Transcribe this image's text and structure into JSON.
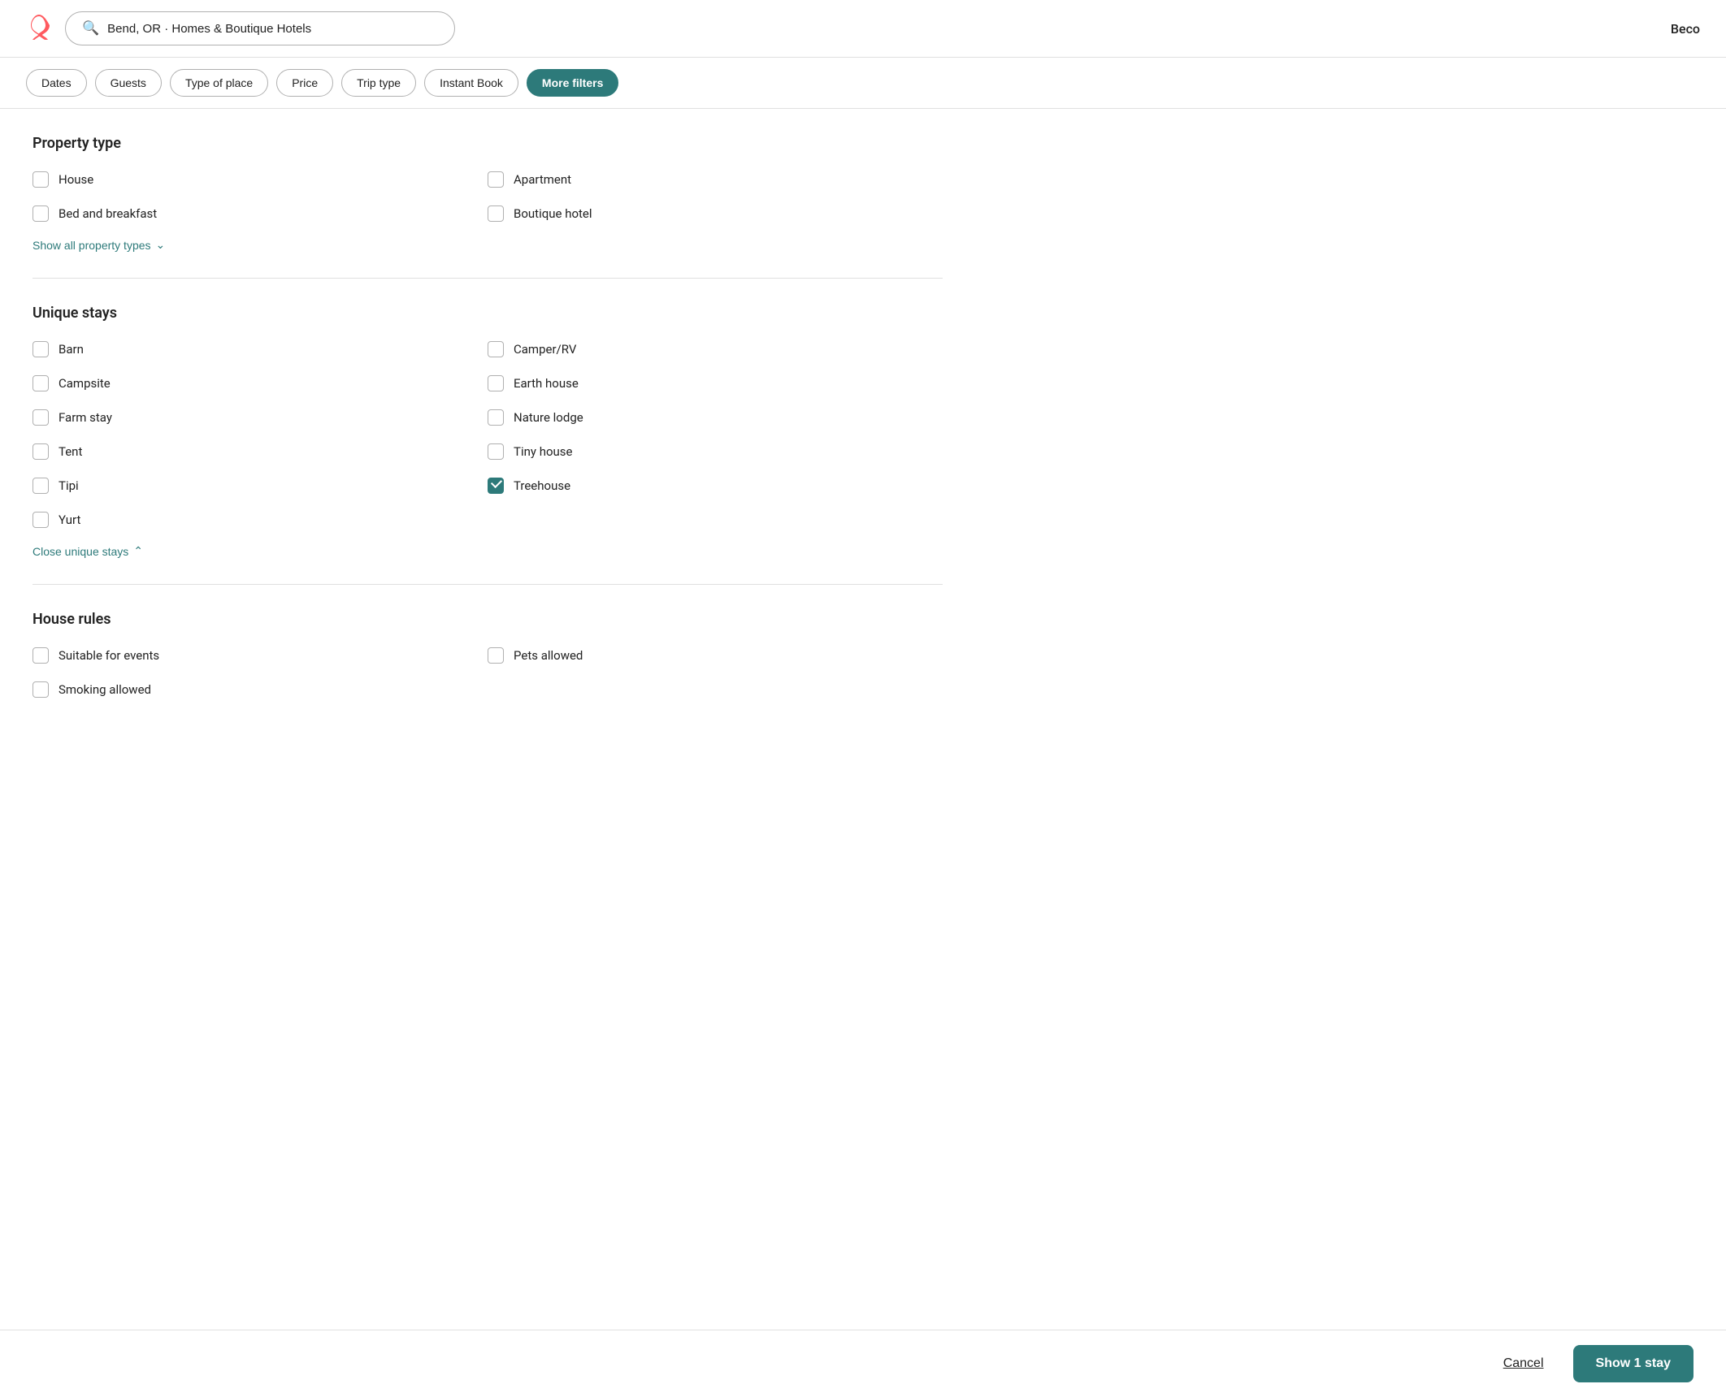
{
  "header": {
    "logo_alt": "Airbnb",
    "search_value": "Bend, OR · Homes & Boutique Hotels",
    "search_placeholder": "Search",
    "user_name": "Beco"
  },
  "filter_bar": {
    "buttons": [
      {
        "id": "dates",
        "label": "Dates",
        "active": false
      },
      {
        "id": "guests",
        "label": "Guests",
        "active": false
      },
      {
        "id": "type-of-place",
        "label": "Type of place",
        "active": false
      },
      {
        "id": "price",
        "label": "Price",
        "active": false
      },
      {
        "id": "trip-type",
        "label": "Trip type",
        "active": false
      },
      {
        "id": "instant-book",
        "label": "Instant Book",
        "active": false
      },
      {
        "id": "more-filters",
        "label": "More filters",
        "active": true
      }
    ]
  },
  "property_type": {
    "title": "Property type",
    "items_left": [
      {
        "id": "house",
        "label": "House",
        "checked": false
      },
      {
        "id": "bed-and-breakfast",
        "label": "Bed and breakfast",
        "checked": false
      }
    ],
    "items_right": [
      {
        "id": "apartment",
        "label": "Apartment",
        "checked": false
      },
      {
        "id": "boutique-hotel",
        "label": "Boutique hotel",
        "checked": false
      }
    ],
    "show_all_label": "Show all property types",
    "show_all_icon": "chevron-down"
  },
  "unique_stays": {
    "title": "Unique stays",
    "items_left": [
      {
        "id": "barn",
        "label": "Barn",
        "checked": false
      },
      {
        "id": "campsite",
        "label": "Campsite",
        "checked": false
      },
      {
        "id": "farm-stay",
        "label": "Farm stay",
        "checked": false
      },
      {
        "id": "tent",
        "label": "Tent",
        "checked": false
      },
      {
        "id": "tipi",
        "label": "Tipi",
        "checked": false
      },
      {
        "id": "yurt",
        "label": "Yurt",
        "checked": false
      }
    ],
    "items_right": [
      {
        "id": "camper-rv",
        "label": "Camper/RV",
        "checked": false
      },
      {
        "id": "earth-house",
        "label": "Earth house",
        "checked": false
      },
      {
        "id": "nature-lodge",
        "label": "Nature lodge",
        "checked": false
      },
      {
        "id": "tiny-house",
        "label": "Tiny house",
        "checked": false
      },
      {
        "id": "treehouse",
        "label": "Treehouse",
        "checked": true
      }
    ],
    "close_label": "Close unique stays",
    "close_icon": "chevron-up"
  },
  "house_rules": {
    "title": "House rules",
    "items_left": [
      {
        "id": "suitable-for-events",
        "label": "Suitable for events",
        "checked": false
      },
      {
        "id": "smoking-allowed",
        "label": "Smoking allowed",
        "checked": false
      }
    ],
    "items_right": [
      {
        "id": "pets-allowed",
        "label": "Pets allowed",
        "checked": false
      }
    ]
  },
  "footer": {
    "cancel_label": "Cancel",
    "show_stays_label": "Show 1 stay"
  }
}
